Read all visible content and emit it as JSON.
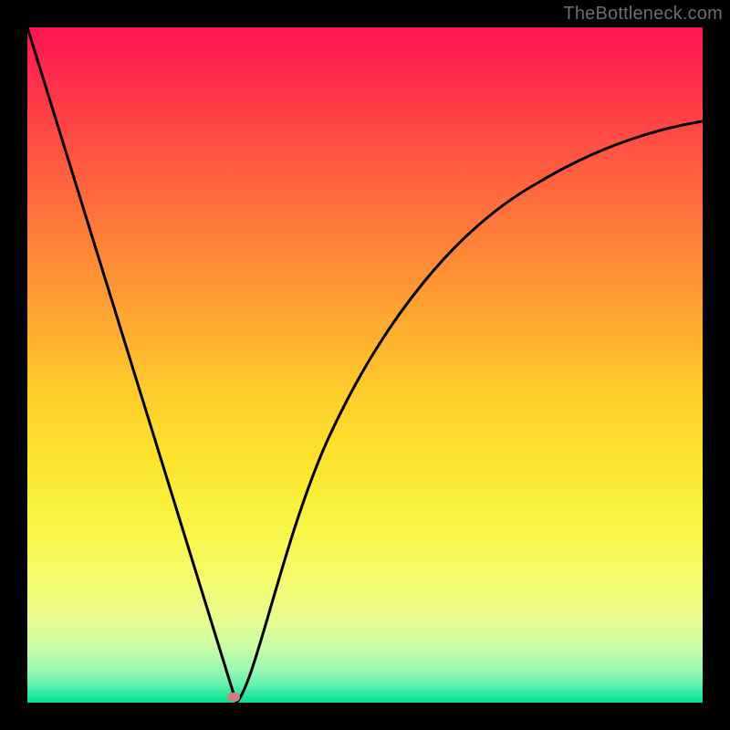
{
  "watermark": "TheBottleneck.com",
  "chart_data": {
    "type": "line",
    "title": "",
    "xlabel": "",
    "ylabel": "",
    "xlim": [
      0,
      1
    ],
    "ylim": [
      0,
      1
    ],
    "grid": false,
    "legend": false,
    "series": [
      {
        "name": "left-branch",
        "x": [
          0.0,
          0.05,
          0.1,
          0.15,
          0.2,
          0.25,
          0.28,
          0.3,
          0.31
        ],
        "y": [
          1.0,
          0.822,
          0.645,
          0.467,
          0.29,
          0.112,
          0.005,
          0.0,
          0.0
        ]
      },
      {
        "name": "right-branch",
        "x": [
          0.31,
          0.33,
          0.36,
          0.4,
          0.45,
          0.5,
          0.55,
          0.6,
          0.65,
          0.7,
          0.75,
          0.8,
          0.85,
          0.9,
          0.95,
          1.0
        ],
        "y": [
          0.0,
          0.05,
          0.135,
          0.255,
          0.387,
          0.49,
          0.572,
          0.64,
          0.694,
          0.737,
          0.772,
          0.8,
          0.822,
          0.838,
          0.851,
          0.86
        ]
      }
    ],
    "marker": {
      "name": "min-point",
      "x": 0.305,
      "y": 0.0
    },
    "background_gradient": {
      "top": "#ff1452",
      "mid": "#ffcf2a",
      "bottom": "#0be090"
    }
  }
}
